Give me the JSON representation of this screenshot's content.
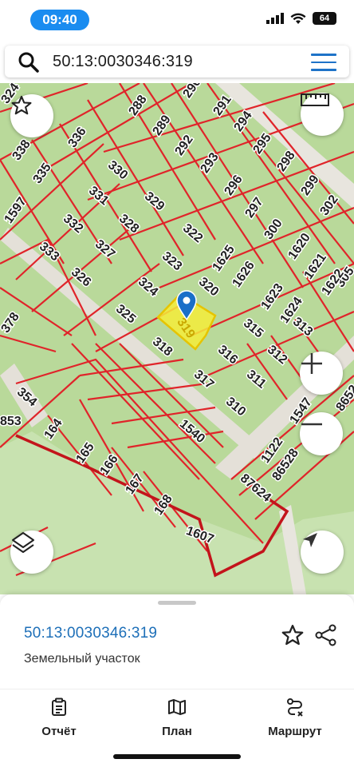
{
  "status": {
    "time": "09:40",
    "battery": "64"
  },
  "search": {
    "value": "50:13:0030346:319"
  },
  "map": {
    "selected_parcel": "319",
    "parcel_labels": [
      "324",
      "338",
      "336",
      "335",
      "1597",
      "288",
      "290",
      "291",
      "289",
      "294",
      "292",
      "295",
      "330",
      "293",
      "298",
      "331",
      "329",
      "296",
      "299",
      "332",
      "328",
      "297",
      "302",
      "333",
      "327",
      "322",
      "300",
      "1620",
      "1625",
      "323",
      "1621",
      "305",
      "326",
      "1626",
      "1622",
      "324",
      "320",
      "1623",
      "325",
      "1624",
      "313",
      "378",
      "318",
      "315",
      "316",
      "312",
      "317",
      "311",
      "354",
      "310",
      "1547",
      "8652",
      "164",
      "1540",
      "1122",
      "853",
      "165",
      "86528",
      "166",
      "87624",
      "167",
      "168",
      "1607"
    ]
  },
  "colors": {
    "accent": "#1a8cf0",
    "parcel_line": "#e0242a",
    "selected": "#f5ec3a",
    "map_bg": "#b9d99a"
  },
  "card": {
    "title": "50:13:0030346:319",
    "subtitle": "Земельный участок"
  },
  "tabs": [
    {
      "label": "Отчёт",
      "icon": "report-icon"
    },
    {
      "label": "План",
      "icon": "map-icon"
    },
    {
      "label": "Маршрут",
      "icon": "route-icon"
    }
  ]
}
